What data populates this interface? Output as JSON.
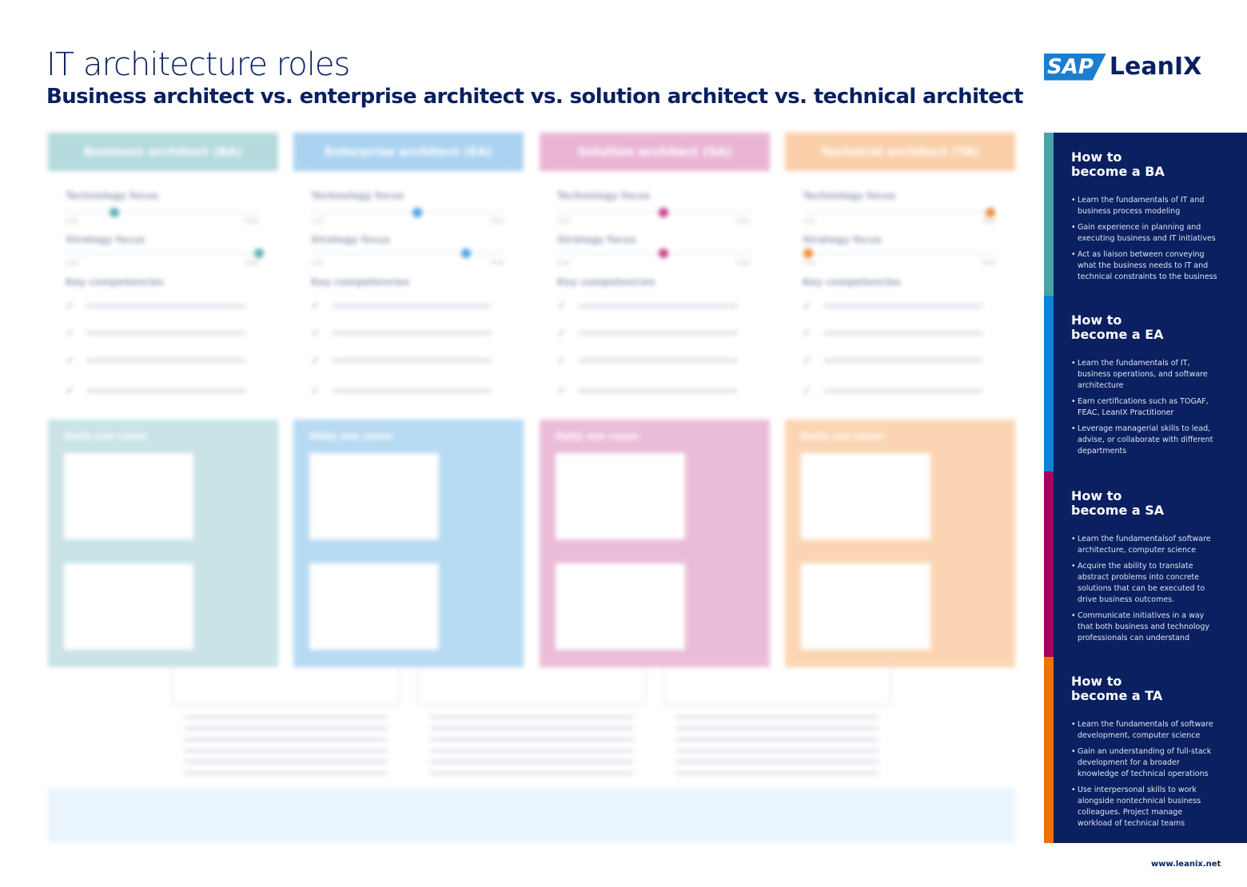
{
  "title": "IT architecture roles",
  "subtitle": "Business architect vs. enterprise architect vs. solution architect vs. technical architect",
  "logo": {
    "brand": "SAP",
    "product": "LeanIX"
  },
  "roles": [
    {
      "name": "Business architect (BA)",
      "color": "#a9d4d8",
      "dot": "#5fb0b5",
      "technology_focus": 0.25,
      "strategy_focus": 1.0,
      "uses_color": "#c9e3e6"
    },
    {
      "name": "Enterprise architect (EA)",
      "color": "#9ccbef",
      "dot": "#4aa3e6",
      "technology_focus": 0.55,
      "strategy_focus": 0.8,
      "uses_color": "#b7daf3"
    },
    {
      "name": "Solution architect (SA)",
      "color": "#e7a8ce",
      "dot": "#c9438f",
      "technology_focus": 0.55,
      "strategy_focus": 0.55,
      "uses_color": "#ebbcd8"
    },
    {
      "name": "Technical architect (TA)",
      "color": "#f9c79a",
      "dot": "#f08a35",
      "technology_focus": 0.97,
      "strategy_focus": 0.03,
      "uses_color": "#fbd5b3"
    }
  ],
  "labels": {
    "technology_focus": "Technology focus",
    "strategy_focus": "Strategy focus",
    "low": "Low",
    "high": "High",
    "key_competencies": "Key competencies",
    "daily_use_cases": "Daily use cases"
  },
  "sidebar": [
    {
      "title": "How to become a BA",
      "color": "#4aa3a8",
      "items": [
        "Learn the fundamentals of IT and business process modeling",
        "Gain experience in planning and executing business and IT initiatives",
        "Act as liaison between conveying what the business needs to IT and technical constraints to the business"
      ]
    },
    {
      "title": "How to become a EA",
      "color": "#0a84d8",
      "items": [
        "Learn the fundamentals of IT, business operations, and software architecture",
        "Earn certifications such as TOGAF, FEAC, LeanIX Practitioner",
        "Leverage managerial skills to lead, advise, or collaborate with different departments"
      ]
    },
    {
      "title": "How to become a SA",
      "color": "#a8005e",
      "items": [
        "Learn the fundamentalsof software architecture, computer science",
        "Acquire the ability to translate abstract problems into concrete solutions that can be executed to drive business outcomes.",
        "Communicate initiatives in a way that both business and technology professionals can understand"
      ]
    },
    {
      "title": "How to become a TA",
      "color": "#f07000",
      "items": [
        "Learn the fundamentals of software development, computer science",
        "Gain an understanding of full-stack development for a broader knowledge of technical operations",
        "Use interpersonal skills to work alongside nontechnical business colleagues. Project manage workload of technical teams"
      ]
    }
  ],
  "footer_url": "www.leanix.net"
}
